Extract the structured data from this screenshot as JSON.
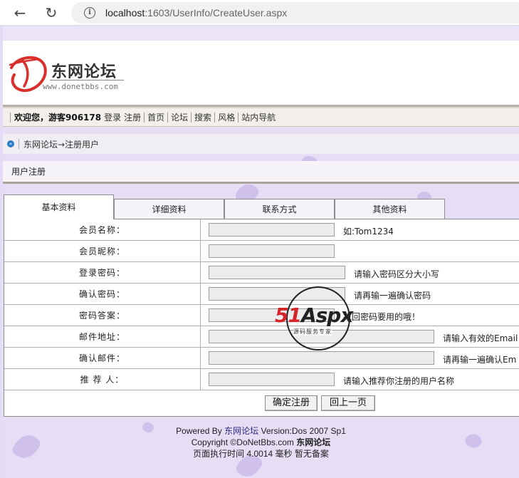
{
  "browser": {
    "url_host": "localhost",
    "url_path": ":1603/UserInfo/CreateUser.aspx"
  },
  "logo": {
    "title": "东网论坛",
    "url": "www.donetbbs.com"
  },
  "menubar": {
    "welcome": "欢迎您，游客906178",
    "login": "登录",
    "register": "注册",
    "home": "首页",
    "forum": "论坛",
    "search": "搜索",
    "style": "风格",
    "sitenav": "站内导航"
  },
  "breadcrumb": {
    "text": "东网论坛→注册用户"
  },
  "section": {
    "title": "用户注册"
  },
  "tabs": [
    {
      "label": "基本资料",
      "active": true
    },
    {
      "label": "详细资料",
      "active": false
    },
    {
      "label": "联系方式",
      "active": false
    },
    {
      "label": "其他资料",
      "active": false
    }
  ],
  "form": {
    "rows": [
      {
        "label": "会员名称：",
        "value": "",
        "hint": "如:Tom1234"
      },
      {
        "label": "会员昵称：",
        "value": "",
        "hint": ""
      },
      {
        "label": "登录密码：",
        "value": "",
        "hint": "请输入密码区分大小写"
      },
      {
        "label": "确认密码：",
        "value": "",
        "hint": "请再输一遍确认密码"
      },
      {
        "label": "密码答案：",
        "value": "",
        "hint": "找回密码要用的哦！"
      },
      {
        "label": "邮件地址：",
        "value": "",
        "hint": "请输入有效的Email"
      },
      {
        "label": "确认邮件：",
        "value": "",
        "hint": "请再输一遍确认Em"
      },
      {
        "label": "推 荐 人：",
        "value": "",
        "hint": "请输入推荐你注册的用户名称"
      }
    ],
    "submit": "确定注册",
    "back": "回上一页"
  },
  "footer": {
    "line1_prefix": "Powered By ",
    "line1_brand": "东网论坛",
    "line1_suffix": " Version:Dos 2007 Sp1",
    "line2_prefix": "Copyright ©DoNetBbs.com ",
    "line2_brand": "东网论坛",
    "line3": "页面执行时间 4.0014 毫秒  暂无备案"
  },
  "watermark": {
    "main_a": "51",
    "main_b": "Aspx",
    "sub": "源码服务专家"
  },
  "icons": {
    "back": "arrow-left-icon",
    "reload": "reload-icon",
    "info": "info-icon",
    "crumb": "chevron-circle-icon"
  },
  "colors": {
    "page_bg": "#e6def5",
    "brand_red": "#d4242a"
  }
}
